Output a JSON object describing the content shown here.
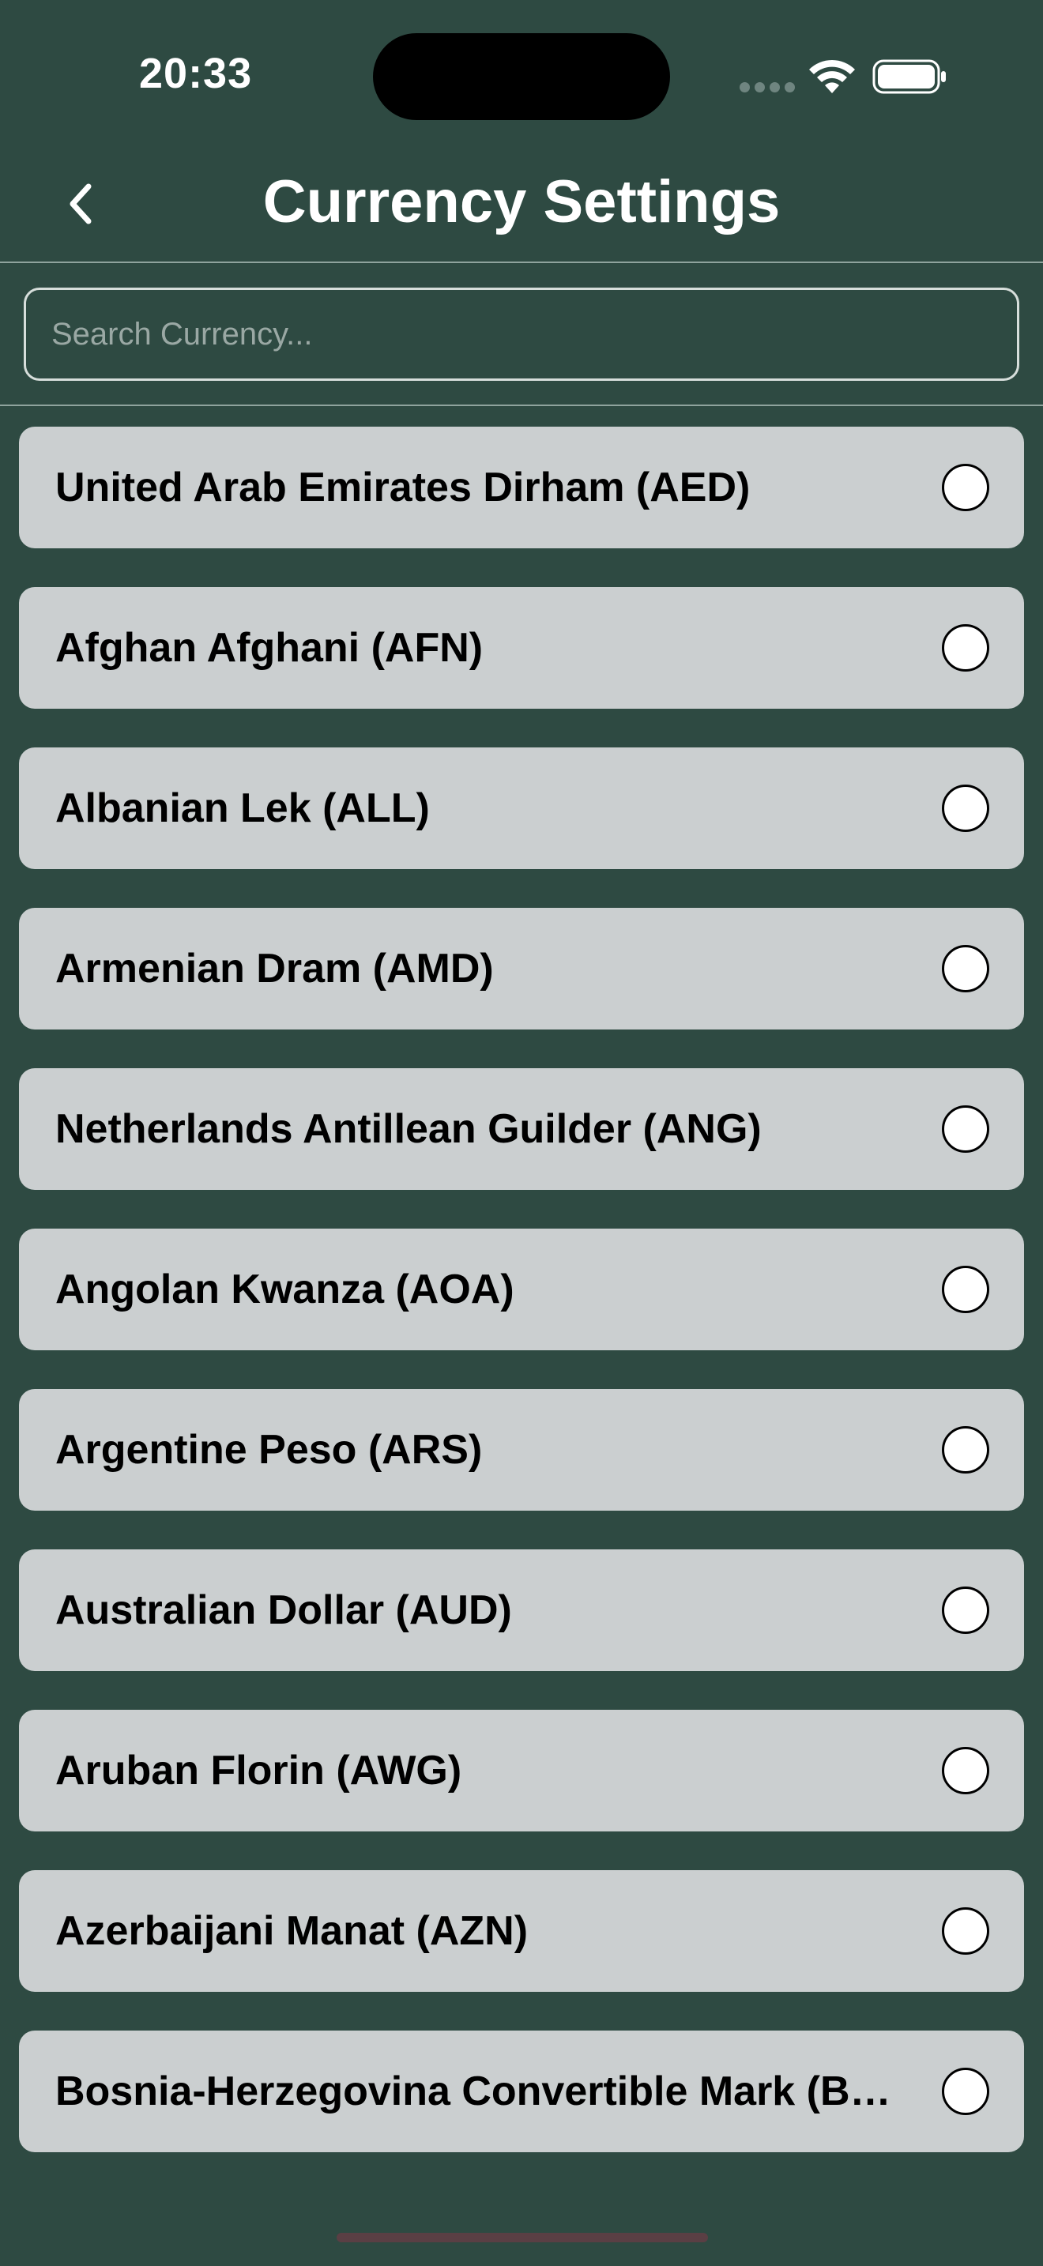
{
  "status_bar": {
    "time": "20:33"
  },
  "header": {
    "title": "Currency Settings",
    "back_icon": "chevron-left-icon"
  },
  "search": {
    "placeholder": "Search Currency...",
    "value": ""
  },
  "currencies": [
    {
      "label": "United Arab Emirates Dirham (AED)",
      "selected": false
    },
    {
      "label": "Afghan Afghani (AFN)",
      "selected": false
    },
    {
      "label": "Albanian Lek (ALL)",
      "selected": false
    },
    {
      "label": "Armenian Dram (AMD)",
      "selected": false
    },
    {
      "label": "Netherlands Antillean Guilder (ANG)",
      "selected": false
    },
    {
      "label": "Angolan Kwanza (AOA)",
      "selected": false
    },
    {
      "label": "Argentine Peso (ARS)",
      "selected": false
    },
    {
      "label": "Australian Dollar (AUD)",
      "selected": false
    },
    {
      "label": "Aruban Florin (AWG)",
      "selected": false
    },
    {
      "label": "Azerbaijani Manat (AZN)",
      "selected": false
    },
    {
      "label": "Bosnia-Herzegovina Convertible Mark (BAM)",
      "selected": false
    }
  ],
  "colors": {
    "background": "#2e4a42",
    "list_item": "#cbcfd0",
    "text_primary": "#000000",
    "header_text": "#ffffff"
  }
}
